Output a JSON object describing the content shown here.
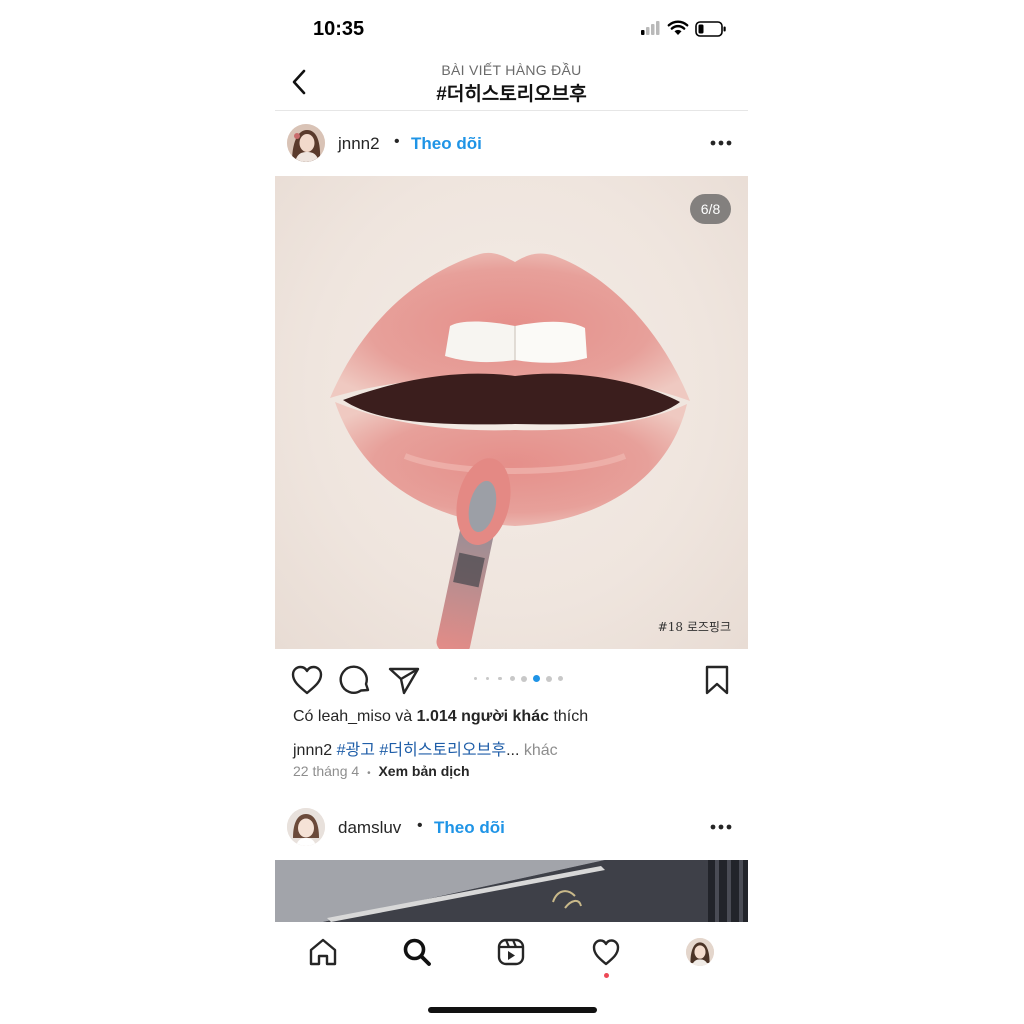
{
  "status_bar": {
    "time": "10:35"
  },
  "header": {
    "subtitle": "BÀI VIẾT HÀNG ĐẦU",
    "title": "#더히스토리오브후"
  },
  "post1": {
    "username": "jnnn2",
    "separator": "•",
    "follow_label": "Theo dõi",
    "image_counter": "6/8",
    "shade_label": "#18 로즈핑크",
    "carousel": {
      "count": 8,
      "active_index": 5
    },
    "likes": {
      "prefix": "Có ",
      "liker": "leah_miso",
      "middle": " và ",
      "others": "1.014 người khác",
      "suffix": " thích"
    },
    "caption": {
      "username": "jnnn2",
      "tag1": "#광고",
      "tag2": "#더히스토리오브후",
      "ellipsis": "...",
      "more": " khác"
    },
    "date": "22 tháng 4",
    "meta_sep": "•",
    "translate_label": "Xem bản dịch"
  },
  "post2": {
    "username": "damsluv",
    "separator": "•",
    "follow_label": "Theo dõi"
  },
  "tabbar": {
    "items": [
      {
        "icon": "home-icon"
      },
      {
        "icon": "search-icon"
      },
      {
        "icon": "reels-icon"
      },
      {
        "icon": "heart-icon"
      },
      {
        "icon": "profile-avatar"
      }
    ]
  },
  "colors": {
    "link_blue": "#1f94e6",
    "hashtag_blue": "#1f5ea8",
    "notif_red": "#ed4956",
    "active_dot": "#1f94e6"
  }
}
